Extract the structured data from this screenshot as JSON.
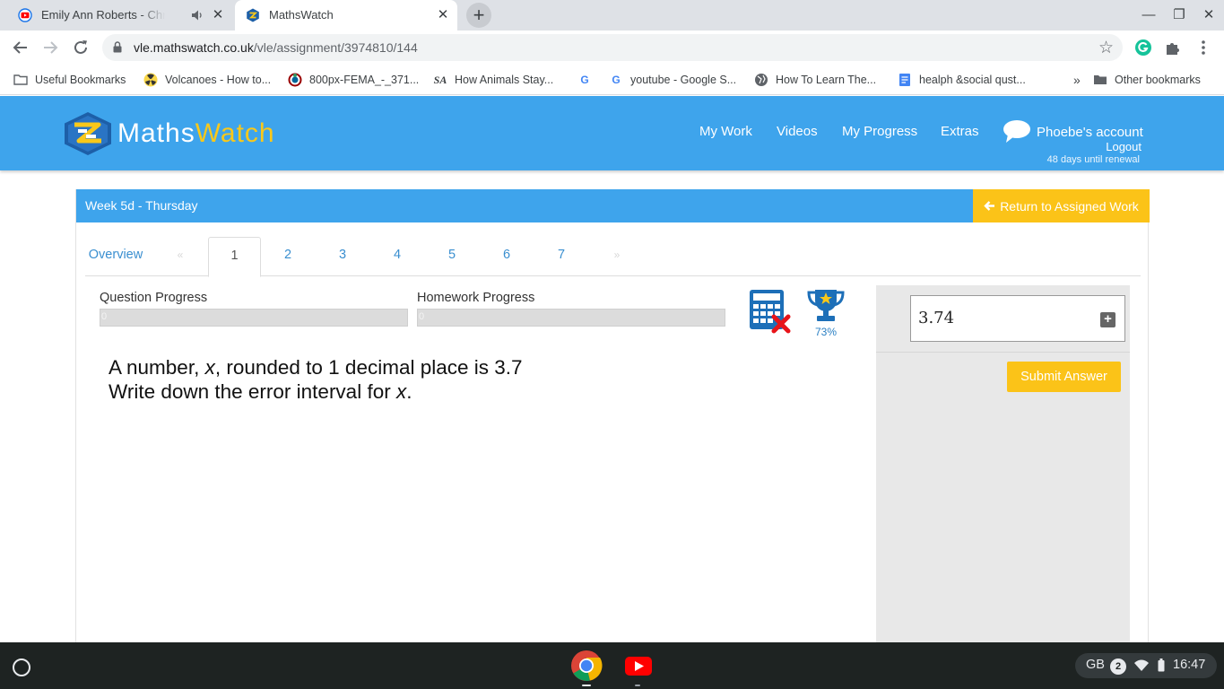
{
  "browser": {
    "tabs": [
      {
        "title": "Emily Ann Roberts - Christmas",
        "active": false
      },
      {
        "title": "MathsWatch",
        "active": true
      }
    ],
    "close_glyph": "✕",
    "new_tab_glyph": "+",
    "window_controls": {
      "minimize": "—",
      "restore": "❐",
      "close": "✕"
    },
    "url_host": "vle.mathswatch.co.uk",
    "url_path": "/vle/assignment/3974810/144",
    "star_glyph": "☆",
    "bookmarks": [
      {
        "label": "Useful Bookmarks",
        "icon": "folder-icon"
      },
      {
        "label": "Volcanoes - How to...",
        "icon": "radiation-icon"
      },
      {
        "label": "800px-FEMA_-_371...",
        "icon": "wikimedia-icon"
      },
      {
        "label": "How Animals Stay...",
        "icon": "sa-icon"
      },
      {
        "label": "",
        "icon": "google-icon"
      },
      {
        "label": "youtube - Google S...",
        "icon": "google-icon"
      },
      {
        "label": "How To Learn The...",
        "icon": "globe-icon"
      },
      {
        "label": "healph &social qust...",
        "icon": "docs-icon"
      }
    ],
    "overflow_glyph": "»",
    "other_bookmarks": "Other bookmarks",
    "sa_glyph": "SA",
    "g_glyph": "G"
  },
  "site": {
    "logo_part1": "Maths",
    "logo_part2": "Watch",
    "nav": [
      "My Work",
      "Videos",
      "My Progress",
      "Extras"
    ],
    "account_name": "Phoebe's account",
    "logout": "Logout",
    "renewal": "48 days until renewal",
    "colors": {
      "header": "#3ea4ec",
      "accent": "#fbc318",
      "logo_yellow": "#f9c81a"
    }
  },
  "assignment": {
    "title": "Week 5d - Thursday",
    "return_label": "Return to Assigned Work",
    "return_glyph": "🡐",
    "tabs": {
      "overview": "Overview",
      "prev": "«",
      "next": "»",
      "numbers": [
        "1",
        "2",
        "3",
        "4",
        "5",
        "6",
        "7"
      ],
      "current": "1"
    },
    "question_progress_label": "Question Progress",
    "question_progress": 0,
    "question_progress_text": "0",
    "homework_progress_label": "Homework Progress",
    "homework_progress": 0,
    "homework_progress_text": "0",
    "calculator": "not allowed",
    "trophy_percent": "73%",
    "question_line1_a": "A number, ",
    "question_var": "x",
    "question_line1_b": ", rounded to 1 decimal place is 3.7",
    "question_line2_a": "Write down the error interval for ",
    "question_line2_b": ".",
    "answer_value": "3.74",
    "plus_glyph": "+",
    "submit_label": "Submit Answer"
  },
  "shelf": {
    "apps": [
      "chrome",
      "youtube"
    ],
    "keyboard": "GB",
    "notifications": "2",
    "time": "16:47"
  }
}
